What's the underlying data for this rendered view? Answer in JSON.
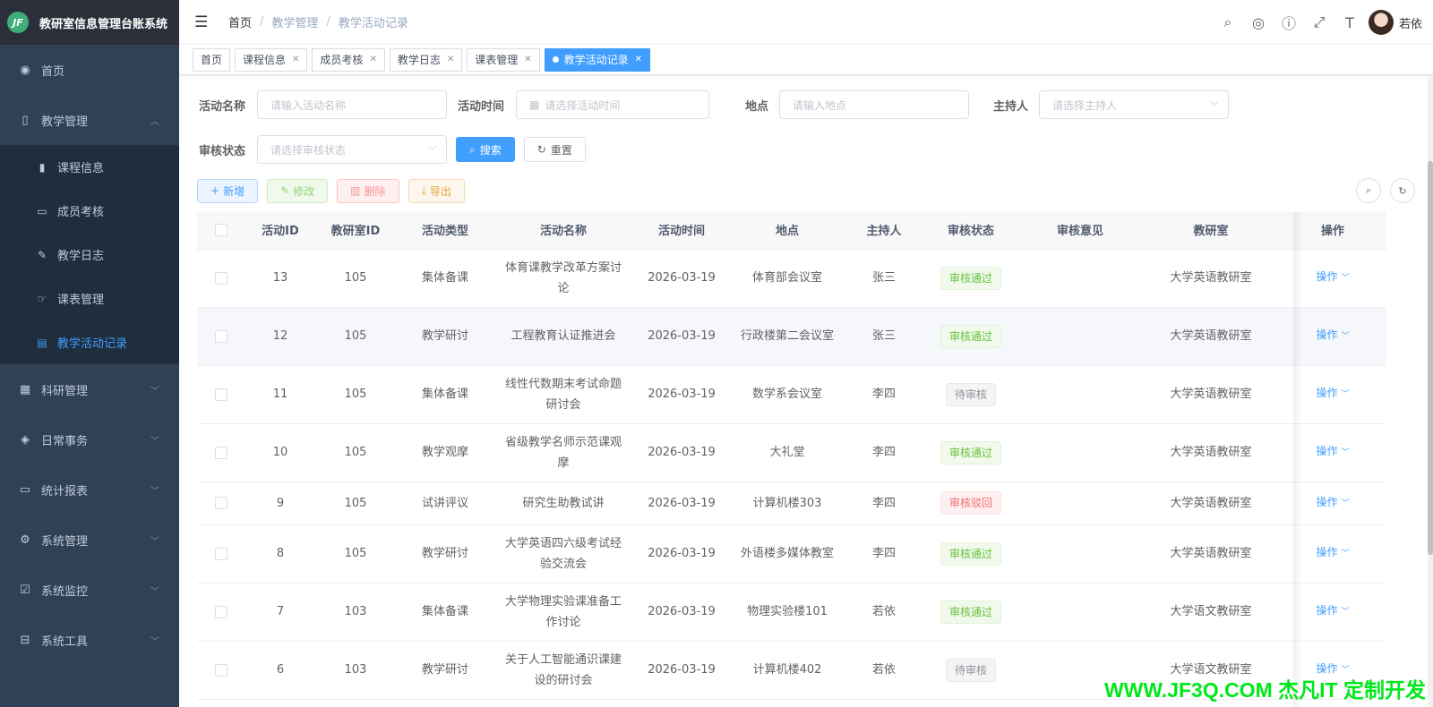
{
  "app": {
    "title": "教研室信息管理台账系统",
    "logo_text": "JF"
  },
  "sidebar": {
    "items": [
      {
        "label": "首页",
        "icon": "dashboard-icon"
      },
      {
        "label": "教学管理",
        "icon": "book-icon",
        "expanded": true
      },
      {
        "label": "科研管理",
        "icon": "grid-icon"
      },
      {
        "label": "日常事务",
        "icon": "layers-icon"
      },
      {
        "label": "统计报表",
        "icon": "monitor-icon"
      },
      {
        "label": "系统管理",
        "icon": "gear-icon"
      },
      {
        "label": "系统监控",
        "icon": "monitor-check-icon"
      },
      {
        "label": "系统工具",
        "icon": "toolbox-icon"
      }
    ],
    "sub_items": [
      {
        "label": "课程信息",
        "icon": "course-icon"
      },
      {
        "label": "成员考核",
        "icon": "card-icon"
      },
      {
        "label": "教学日志",
        "icon": "edit-icon"
      },
      {
        "label": "课表管理",
        "icon": "hand-icon"
      },
      {
        "label": "教学活动记录",
        "icon": "document-icon",
        "active": true
      }
    ]
  },
  "breadcrumb": [
    "首页",
    "教学管理",
    "教学活动记录"
  ],
  "header": {
    "username": "若依"
  },
  "tabs": [
    {
      "label": "首页",
      "closable": false
    },
    {
      "label": "课程信息",
      "closable": true
    },
    {
      "label": "成员考核",
      "closable": true
    },
    {
      "label": "教学日志",
      "closable": true
    },
    {
      "label": "课表管理",
      "closable": true
    },
    {
      "label": "教学活动记录",
      "closable": true,
      "active": true
    }
  ],
  "search": {
    "activity_name": {
      "label": "活动名称",
      "placeholder": "请输入活动名称"
    },
    "activity_time": {
      "label": "活动时间",
      "placeholder": "请选择活动时间"
    },
    "location": {
      "label": "地点",
      "placeholder": "请输入地点"
    },
    "host": {
      "label": "主持人",
      "placeholder": "请选择主持人"
    },
    "status": {
      "label": "审核状态",
      "placeholder": "请选择审核状态"
    },
    "search_label": "搜索",
    "reset_label": "重置"
  },
  "toolbar": {
    "add": "新增",
    "edit": "修改",
    "delete": "删除",
    "export": "导出"
  },
  "table": {
    "columns": [
      "活动ID",
      "教研室ID",
      "活动类型",
      "活动名称",
      "活动时间",
      "地点",
      "主持人",
      "审核状态",
      "审核意见",
      "教研室",
      "操作"
    ],
    "op_label": "操作",
    "rows": [
      {
        "id": "13",
        "room_id": "105",
        "type": "集体备课",
        "name": "体育课教学改革方案讨论",
        "time": "2026-03-19",
        "location": "体育部会议室",
        "host": "张三",
        "status": "审核通过",
        "status_type": "pass",
        "opinion": "",
        "room": "大学英语教研室"
      },
      {
        "id": "12",
        "room_id": "105",
        "type": "教学研讨",
        "name": "工程教育认证推进会",
        "time": "2026-03-19",
        "location": "行政楼第二会议室",
        "host": "张三",
        "status": "审核通过",
        "status_type": "pass",
        "opinion": "",
        "room": "大学英语教研室"
      },
      {
        "id": "11",
        "room_id": "105",
        "type": "集体备课",
        "name": "线性代数期末考试命题研讨会",
        "time": "2026-03-19",
        "location": "数学系会议室",
        "host": "李四",
        "status": "待审核",
        "status_type": "wait",
        "opinion": "",
        "room": "大学英语教研室"
      },
      {
        "id": "10",
        "room_id": "105",
        "type": "教学观摩",
        "name": "省级教学名师示范课观摩",
        "time": "2026-03-19",
        "location": "大礼堂",
        "host": "李四",
        "status": "审核通过",
        "status_type": "pass",
        "opinion": "",
        "room": "大学英语教研室"
      },
      {
        "id": "9",
        "room_id": "105",
        "type": "试讲评议",
        "name": "研究生助教试讲",
        "time": "2026-03-19",
        "location": "计算机楼303",
        "host": "李四",
        "status": "审核驳回",
        "status_type": "reject",
        "opinion": "",
        "room": "大学英语教研室"
      },
      {
        "id": "8",
        "room_id": "105",
        "type": "教学研讨",
        "name": "大学英语四六级考试经验交流会",
        "time": "2026-03-19",
        "location": "外语楼多媒体教室",
        "host": "李四",
        "status": "审核通过",
        "status_type": "pass",
        "opinion": "",
        "room": "大学英语教研室"
      },
      {
        "id": "7",
        "room_id": "103",
        "type": "集体备课",
        "name": "大学物理实验课准备工作讨论",
        "time": "2026-03-19",
        "location": "物理实验楼101",
        "host": "若依",
        "status": "审核通过",
        "status_type": "pass",
        "opinion": "",
        "room": "大学语文教研室"
      },
      {
        "id": "6",
        "room_id": "103",
        "type": "教学研讨",
        "name": "关于人工智能通识课建设的研讨会",
        "time": "2026-03-19",
        "location": "计算机楼402",
        "host": "若依",
        "status": "待审核",
        "status_type": "wait",
        "opinion": "",
        "room": "大学语文教研室"
      }
    ]
  },
  "watermark": "WWW.JF3Q.COM 杰凡IT 定制开发"
}
